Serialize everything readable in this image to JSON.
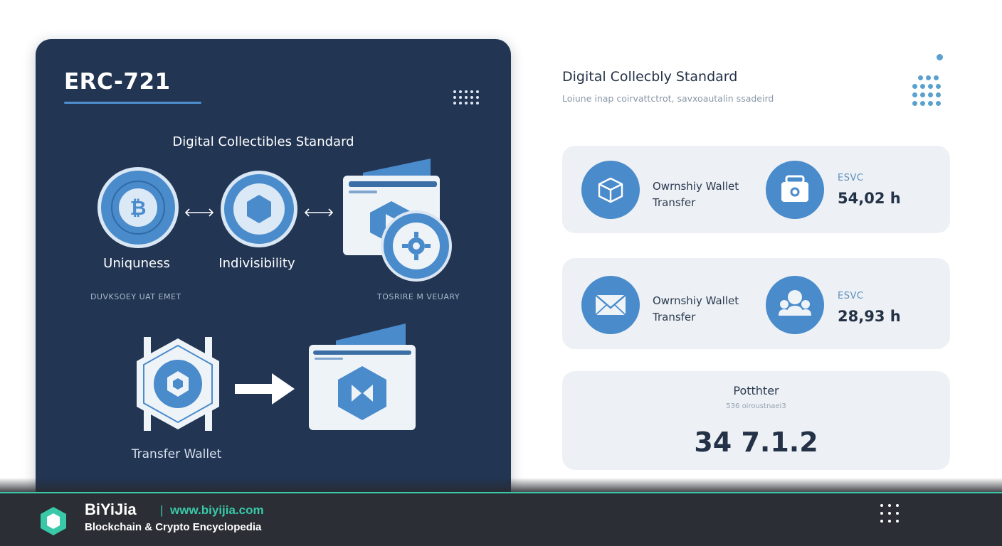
{
  "left_panel": {
    "title": "ERC-721",
    "subtitle": "Digital Collectibles Standard",
    "items": [
      {
        "label": "Uniquness",
        "icon": "bitcoin-coin-icon"
      },
      {
        "label": "Indivisibility",
        "icon": "hexagon-token-icon"
      },
      {
        "icon": "wallet-gear-icon"
      }
    ],
    "caption_left": "DUVKSOEY UAT EMET",
    "caption_right": "TOSRIRE M VEUARY",
    "transfer_label": "Transfer Wallet"
  },
  "right_section": {
    "title": "Digital Collecbly Standard",
    "subtitle": "Loiune inap coirvattctrot, savxoautalin ssadeird",
    "cards": [
      {
        "line1": "Owrnshiy Wallet",
        "line2": "Transfer",
        "badge": "ESVC",
        "value": "54,02 h",
        "left_icon": "cube-icon",
        "right_icon": "lock-icon"
      },
      {
        "line1": "Owrnshiy Wallet",
        "line2": "Transfer",
        "badge": "ESVC",
        "value": "28,93 h",
        "left_icon": "envelope-icon",
        "right_icon": "users-icon"
      }
    ],
    "potential": {
      "title": "Potthter",
      "subtitle": "536 oiroustnaei3",
      "value": "34 7.1.2"
    }
  },
  "footer": {
    "brand": "BiYiJia",
    "separator": "|",
    "url": "www.biyijia.com",
    "tagline": "Blockchain & Crypto Encyclopedia"
  },
  "colors": {
    "panel": "#223553",
    "accent_blue": "#4a8bcb",
    "card_bg": "#edf1f5",
    "footer_bg": "#2b2e34",
    "footer_accent": "#39c9a8"
  }
}
